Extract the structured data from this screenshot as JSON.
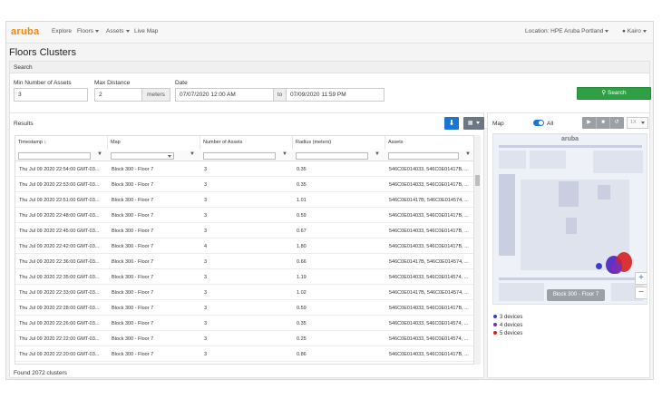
{
  "nav": {
    "logo": "aruba",
    "items": [
      "Explore",
      "Floors",
      "Assets",
      "Live Map"
    ],
    "location_label": "Location: HPE Aruba Portland",
    "user": "Kairo"
  },
  "page": {
    "title": "Floors Clusters"
  },
  "search": {
    "header": "Search",
    "min_assets_label": "Min Number of Assets",
    "min_assets_value": "3",
    "max_distance_label": "Max Distance",
    "max_distance_value": "2",
    "distance_unit": "meters",
    "date_label": "Date",
    "date_from": "07/07/2020 12:00 AM",
    "date_sep": "to",
    "date_to": "07/09/2020 11:59 PM",
    "button": "Search"
  },
  "results": {
    "header": "Results",
    "columns": [
      "Timestamp",
      "Map",
      "Number of Assets",
      "Radius (meters)",
      "Assets"
    ],
    "rows": [
      [
        "Thu Jul 09 2020 22:54:00 GMT-03...",
        "Block 300 - Floor 7",
        "3",
        "0.35",
        "546C0E014033, 546C0E01417B, ..."
      ],
      [
        "Thu Jul 09 2020 22:53:00 GMT-03...",
        "Block 300 - Floor 7",
        "3",
        "0.35",
        "546C0E014033, 546C0E01417B, ..."
      ],
      [
        "Thu Jul 09 2020 22:51:00 GMT-03...",
        "Block 300 - Floor 7",
        "3",
        "1.01",
        "546C0E01417B, 546C0E014574, ..."
      ],
      [
        "Thu Jul 09 2020 22:48:00 GMT-03...",
        "Block 300 - Floor 7",
        "3",
        "0.59",
        "546C0E014033, 546C0E01417B, ..."
      ],
      [
        "Thu Jul 09 2020 22:45:00 GMT-03...",
        "Block 300 - Floor 7",
        "3",
        "0.67",
        "546C0E014033, 546C0E01417B, ..."
      ],
      [
        "Thu Jul 09 2020 22:42:00 GMT-03...",
        "Block 300 - Floor 7",
        "4",
        "1.80",
        "546C0E014033, 546C0E01417B, ..."
      ],
      [
        "Thu Jul 09 2020 22:36:00 GMT-03...",
        "Block 300 - Floor 7",
        "3",
        "0.66",
        "546C0E01417B, 546C0E014574, ..."
      ],
      [
        "Thu Jul 09 2020 22:35:00 GMT-03...",
        "Block 300 - Floor 7",
        "3",
        "1.19",
        "546C0E014033, 546C0E014574, ..."
      ],
      [
        "Thu Jul 09 2020 22:33:00 GMT-03...",
        "Block 300 - Floor 7",
        "3",
        "1.02",
        "546C0E01417B, 546C0E014574, ..."
      ],
      [
        "Thu Jul 09 2020 22:28:00 GMT-03...",
        "Block 300 - Floor 7",
        "3",
        "0.59",
        "546C0E014033, 546C0E01417B, ..."
      ],
      [
        "Thu Jul 09 2020 22:26:00 GMT-03...",
        "Block 300 - Floor 7",
        "3",
        "0.35",
        "546C0E014033, 546C0E014574, ..."
      ],
      [
        "Thu Jul 09 2020 22:22:00 GMT-03...",
        "Block 300 - Floor 7",
        "3",
        "0.25",
        "546C0E014033, 546C0E014574, ..."
      ],
      [
        "Thu Jul 09 2020 22:20:00 GMT-03...",
        "Block 300 - Floor 7",
        "3",
        "0.86",
        "546C0E014033, 546C0E01417B, ..."
      ]
    ],
    "footer": "Found 2072 clusters"
  },
  "map": {
    "label": "Map",
    "toggle_label": "All",
    "speed": "1X",
    "logo": "aruba",
    "tooltip": "Block 300 - Floor 7",
    "legend": [
      {
        "label": "3 devices",
        "color": "#3b3bd6"
      },
      {
        "label": "4 devices",
        "color": "#7a2fb5"
      },
      {
        "label": "5 devices",
        "color": "#d62020"
      }
    ]
  }
}
